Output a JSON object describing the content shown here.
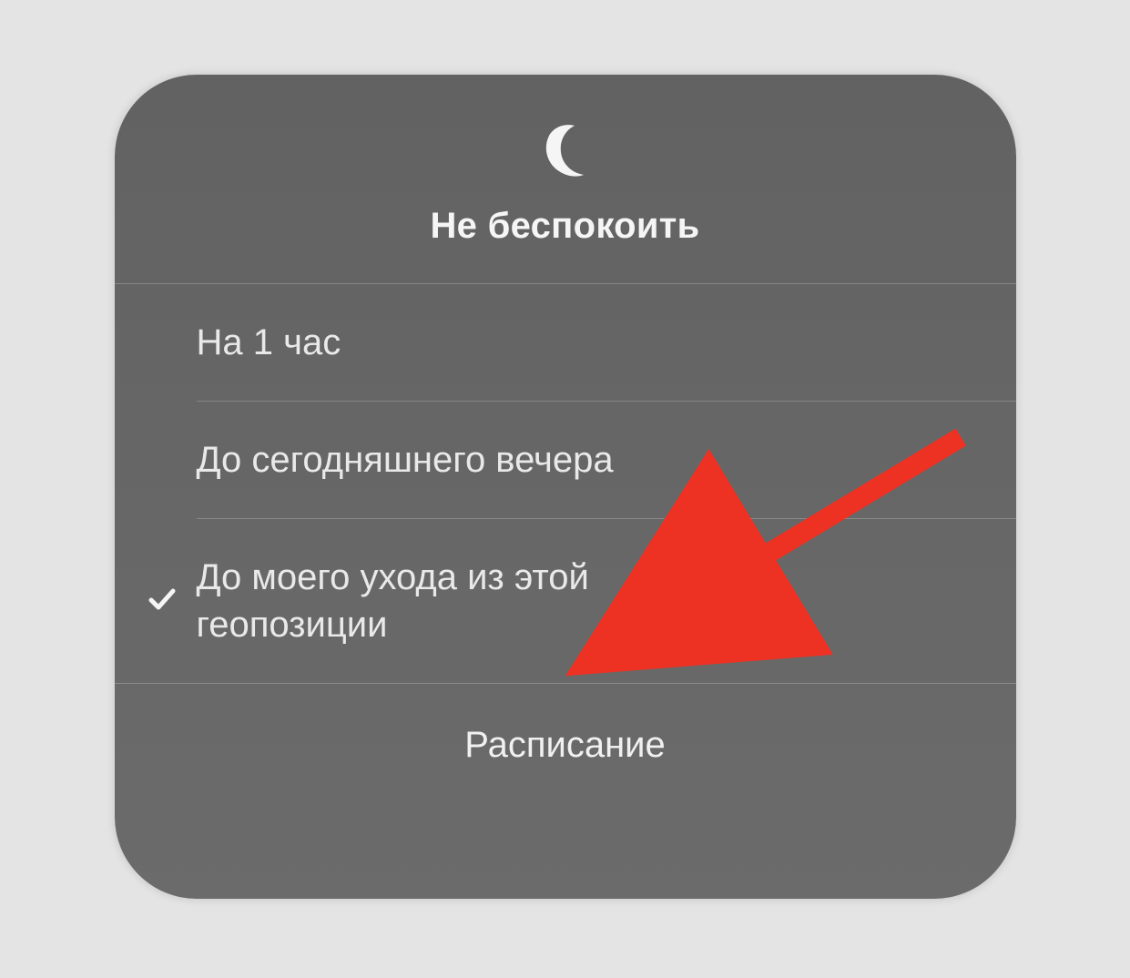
{
  "panel": {
    "title": "Не беспокоить",
    "icon_name": "moon-icon",
    "options": [
      {
        "label": "На 1 час",
        "selected": false
      },
      {
        "label": "До сегодняшнего вечера",
        "selected": false
      },
      {
        "label": "До моего ухода из этой геопозиции",
        "selected": true
      }
    ],
    "footer": {
      "schedule_label": "Расписание"
    }
  },
  "annotation": {
    "arrow_color": "#ed3224"
  }
}
